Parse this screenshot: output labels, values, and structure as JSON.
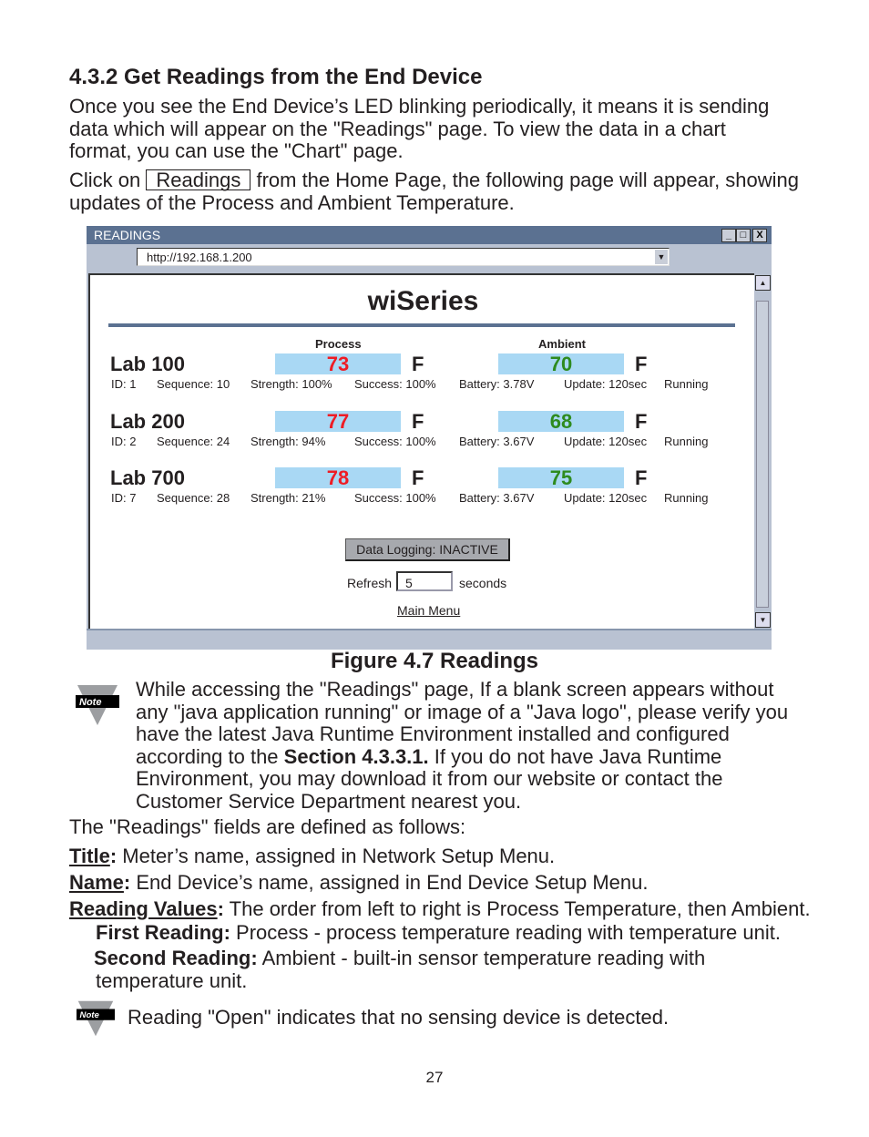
{
  "section": {
    "heading": "4.3.2  Get Readings from the End Device",
    "para1": [
      "Once you see the End Device’s LED blinking periodically, it means it is sending",
      "data which will appear on the \"Readings\" page. To view the data in a chart",
      "format, you can use the \"Chart\" page."
    ],
    "para2_pre": "Click on",
    "para2_button": "Readings",
    "para2_post": "from the Home Page, the following page will appear, showing",
    "para2_line2": "updates of the Process and Ambient Temperature."
  },
  "window": {
    "title": "READINGS",
    "address": "http://192.168.1.200",
    "page_title": "wiSeries",
    "process_label": "Process",
    "ambient_label": "Ambient",
    "process_color": "#ee1c25",
    "ambient_color": "#2e8b1f",
    "box_color": "#a9d8f4",
    "rows": [
      {
        "name": "Lab 100",
        "id": "ID: 1",
        "sequence": "Sequence: 10",
        "process": "73",
        "process_unit": "F",
        "strength": "Strength: 100%",
        "success": "Success: 100%",
        "ambient": "70",
        "ambient_unit": "F",
        "battery": "Battery: 3.78V",
        "update": "Update: 120sec",
        "state": "Running"
      },
      {
        "name": "Lab 200",
        "id": "ID: 2",
        "sequence": "Sequence: 24",
        "process": "77",
        "process_unit": "F",
        "strength": "Strength: 94%",
        "success": "Success: 100%",
        "ambient": "68",
        "ambient_unit": "F",
        "battery": "Battery: 3.67V",
        "update": "Update: 120sec",
        "state": "Running"
      },
      {
        "name": "Lab 700",
        "id": "ID: 7",
        "sequence": "Sequence: 28",
        "process": "78",
        "process_unit": "F",
        "strength": "Strength: 21%",
        "success": "Success: 100%",
        "ambient": "75",
        "ambient_unit": "F",
        "battery": "Battery: 3.67V",
        "update": "Update: 120sec",
        "state": "Running"
      }
    ],
    "logging_button": "Data Logging: INACTIVE",
    "refresh_label": "Refresh",
    "refresh_value": "5",
    "seconds_label": "seconds",
    "main_menu": "Main Menu"
  },
  "figure_caption": "Figure 4.7  Readings",
  "note_label": "Note",
  "note1": [
    "While accessing the \"Readings\" page, If a blank screen appears without",
    "any \"java application running\" or image of a \"Java logo\", please verify you",
    "have the latest Java Runtime Environment installed and configured"
  ],
  "note1_l4_pre": "according to the ",
  "note1_l4_bold": "Section 4.3.3.1.",
  "note1_l4_post": "  If you do not have Java Runtime",
  "note1_rest": [
    "Environment, you may download it from our website or contact the",
    "Customer Service Department nearest you."
  ],
  "fields_intro": "The \"Readings\" fields are defined as follows:",
  "defs": [
    {
      "term": "Title",
      "colon": ":",
      "text": "  Meter’s name, assigned in Network Setup Menu."
    },
    {
      "term": "Name",
      "colon": ":",
      "text": "  End Device’s name, assigned in End Device Setup Menu."
    },
    {
      "term": "Reading Values",
      "colon": ":",
      "text": " The order from left to right is Process Temperature, then Ambient."
    }
  ],
  "first_reading": {
    "term": "First Reading:",
    "text": "  Process - process temperature reading with temperature unit."
  },
  "second_reading": {
    "term": "Second Reading:",
    "text": "  Ambient - built-in sensor temperature reading with",
    "line2": "temperature unit."
  },
  "note2": "Reading \"Open\" indicates that no sensing device is detected.",
  "page_number": "27"
}
